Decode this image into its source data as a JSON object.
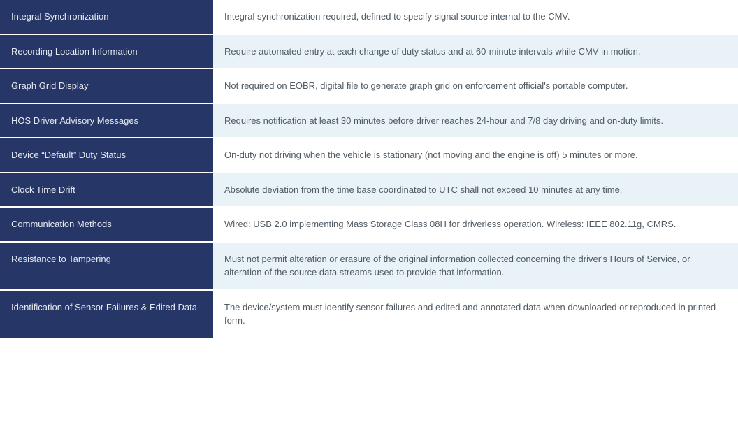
{
  "rows": [
    {
      "label": "Integral Synchronization",
      "desc": "Integral synchronization required, defined to specify signal source internal to the CMV."
    },
    {
      "label": "Recording Location Information",
      "desc": "Require automated entry at each change of duty status and at 60-minute intervals while CMV in motion."
    },
    {
      "label": "Graph Grid Display",
      "desc": "Not required on EOBR, digital file to generate graph grid on enforcement official's portable computer."
    },
    {
      "label": "HOS Driver Advisory Messages",
      "desc": "Requires notification at least 30 minutes before driver reaches 24-hour and 7/8 day driving and on-duty limits."
    },
    {
      "label": "Device “Default” Duty Status",
      "desc": "On-duty not driving when the vehicle is stationary (not moving and the engine is off) 5 minutes or more."
    },
    {
      "label": "Clock Time Drift",
      "desc": "Absolute deviation from the time base coordinated to UTC shall not exceed 10 minutes at any time."
    },
    {
      "label": "Communication Methods",
      "desc": "Wired: USB 2.0 implementing Mass Storage Class 08H for driverless operation. Wireless: IEEE 802.11g, CMRS."
    },
    {
      "label": "Resistance to Tampering",
      "desc": "Must not permit alteration or erasure of the original information collected concerning the driver's Hours of Service, or alteration of the source data streams used to provide that information."
    },
    {
      "label": "Identification of Sensor Failures & Edited Data",
      "desc": "The device/system must identify sensor failures and edited and annotated data when downloaded or reproduced in printed form."
    }
  ]
}
